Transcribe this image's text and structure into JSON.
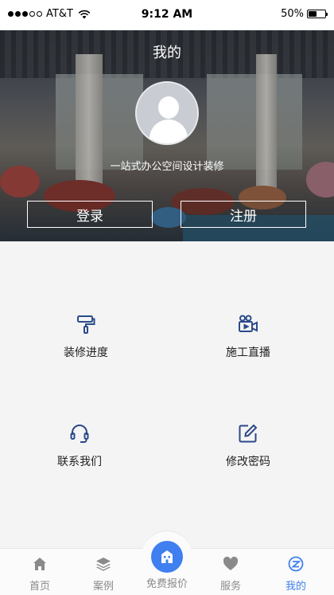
{
  "status_bar": {
    "carrier": "AT&T",
    "time": "9:12 AM",
    "battery": "50%",
    "battery_level": 0.5,
    "signal_bars": 3
  },
  "hero": {
    "title": "我的",
    "tagline": "一站式办公空间设计装修",
    "login_label": "登录",
    "register_label": "注册"
  },
  "menu": {
    "items": [
      {
        "label": "装修进度",
        "icon": "paint-roller-icon"
      },
      {
        "label": "施工直播",
        "icon": "video-camera-icon"
      },
      {
        "label": "联系我们",
        "icon": "headset-icon"
      },
      {
        "label": "修改密码",
        "icon": "edit-icon"
      }
    ],
    "icon_color": "#2b4a8a"
  },
  "tabbar": {
    "items": [
      {
        "label": "首页",
        "icon": "home-icon"
      },
      {
        "label": "案例",
        "icon": "layers-icon"
      },
      {
        "label": "免费报价",
        "icon": "building-icon"
      },
      {
        "label": "服务",
        "icon": "heart-icon"
      },
      {
        "label": "我的",
        "icon": "profile-icon"
      }
    ],
    "active": "我的",
    "accent_color": "#3f7ff0",
    "inactive_color": "#8a8a8a"
  }
}
